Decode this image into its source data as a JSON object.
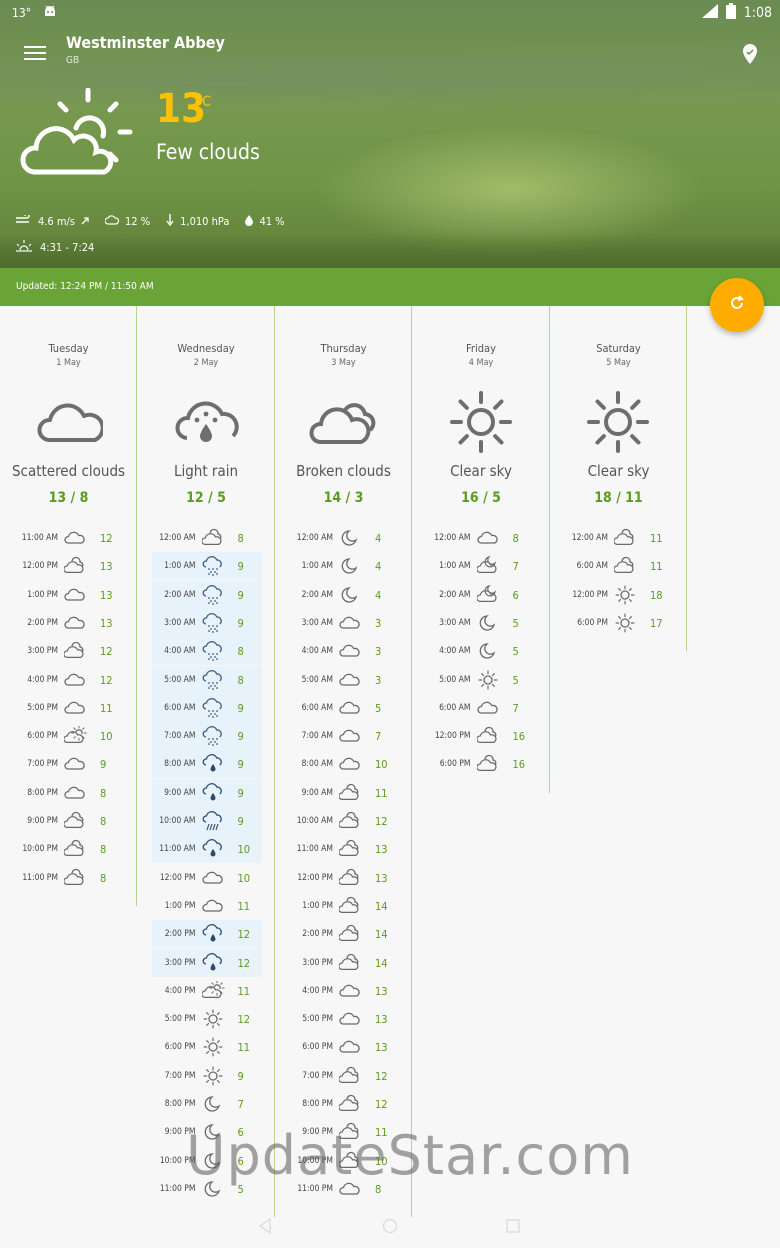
{
  "status": {
    "temp": "13°",
    "time": "1:08",
    "network": "LTE"
  },
  "location": {
    "name": "Westminster Abbey",
    "country": "GB"
  },
  "current": {
    "temp": "13",
    "unit": "°C",
    "condition": "Few clouds",
    "wind": "4.6 m/s",
    "clouds": "12 %",
    "pressure": "1,010 hPa",
    "humidity": "41 %",
    "sun": "4:31 - 7:24"
  },
  "updated": "Updated: 12:24 PM / 11:50 AM",
  "colors": {
    "accent": "#ffab00",
    "green": "#6aa336",
    "temp_yellow": "#ffc107",
    "value_green": "#5b9b1f"
  },
  "days": [
    {
      "name": "Tuesday",
      "date": "1 May",
      "icon": "cloud",
      "condition": "Scattered clouds",
      "range": "13 / 8",
      "hours": [
        {
          "t": "11:00 AM",
          "i": "cloud",
          "v": "12"
        },
        {
          "t": "12:00 PM",
          "i": "clouds",
          "v": "13"
        },
        {
          "t": "1:00 PM",
          "i": "cloud",
          "v": "13"
        },
        {
          "t": "2:00 PM",
          "i": "cloud",
          "v": "13"
        },
        {
          "t": "3:00 PM",
          "i": "clouds",
          "v": "12"
        },
        {
          "t": "4:00 PM",
          "i": "cloud",
          "v": "12"
        },
        {
          "t": "5:00 PM",
          "i": "cloud",
          "v": "11"
        },
        {
          "t": "6:00 PM",
          "i": "sun-cloud",
          "v": "10"
        },
        {
          "t": "7:00 PM",
          "i": "cloud",
          "v": "9"
        },
        {
          "t": "8:00 PM",
          "i": "cloud",
          "v": "8"
        },
        {
          "t": "9:00 PM",
          "i": "clouds",
          "v": "8"
        },
        {
          "t": "10:00 PM",
          "i": "clouds",
          "v": "8"
        },
        {
          "t": "11:00 PM",
          "i": "clouds",
          "v": "8"
        }
      ]
    },
    {
      "name": "Wednesday",
      "date": "2 May",
      "icon": "rain",
      "condition": "Light rain",
      "range": "12 / 5",
      "hours": [
        {
          "t": "12:00 AM",
          "i": "clouds",
          "v": "8"
        },
        {
          "t": "1:00 AM",
          "i": "snow",
          "v": "9",
          "r": 1
        },
        {
          "t": "2:00 AM",
          "i": "snow",
          "v": "9",
          "r": 1
        },
        {
          "t": "3:00 AM",
          "i": "snow",
          "v": "9",
          "r": 1
        },
        {
          "t": "4:00 AM",
          "i": "snow",
          "v": "8",
          "r": 1
        },
        {
          "t": "5:00 AM",
          "i": "snow",
          "v": "8",
          "r": 1
        },
        {
          "t": "6:00 AM",
          "i": "snow",
          "v": "9",
          "r": 1
        },
        {
          "t": "7:00 AM",
          "i": "snow",
          "v": "9",
          "r": 1
        },
        {
          "t": "8:00 AM",
          "i": "rain",
          "v": "9",
          "r": 1
        },
        {
          "t": "9:00 AM",
          "i": "rain",
          "v": "9",
          "r": 1
        },
        {
          "t": "10:00 AM",
          "i": "showers",
          "v": "9",
          "r": 1
        },
        {
          "t": "11:00 AM",
          "i": "rain",
          "v": "10",
          "r": 1
        },
        {
          "t": "12:00 PM",
          "i": "cloud",
          "v": "10"
        },
        {
          "t": "1:00 PM",
          "i": "cloud",
          "v": "11"
        },
        {
          "t": "2:00 PM",
          "i": "rain",
          "v": "12",
          "r": 1
        },
        {
          "t": "3:00 PM",
          "i": "rain",
          "v": "12",
          "r": 1
        },
        {
          "t": "4:00 PM",
          "i": "sun-cloud",
          "v": "11"
        },
        {
          "t": "5:00 PM",
          "i": "sun",
          "v": "12"
        },
        {
          "t": "6:00 PM",
          "i": "sun",
          "v": "11"
        },
        {
          "t": "7:00 PM",
          "i": "sun",
          "v": "9"
        },
        {
          "t": "8:00 PM",
          "i": "moon",
          "v": "7"
        },
        {
          "t": "9:00 PM",
          "i": "moon",
          "v": "6"
        },
        {
          "t": "10:00 PM",
          "i": "moon",
          "v": "6"
        },
        {
          "t": "11:00 PM",
          "i": "moon",
          "v": "5"
        }
      ]
    },
    {
      "name": "Thursday",
      "date": "3 May",
      "icon": "clouds",
      "condition": "Broken clouds",
      "range": "14 / 3",
      "hours": [
        {
          "t": "12:00 AM",
          "i": "moon",
          "v": "4"
        },
        {
          "t": "1:00 AM",
          "i": "moon",
          "v": "4"
        },
        {
          "t": "2:00 AM",
          "i": "moon",
          "v": "4"
        },
        {
          "t": "3:00 AM",
          "i": "cloud",
          "v": "3"
        },
        {
          "t": "4:00 AM",
          "i": "cloud",
          "v": "3"
        },
        {
          "t": "5:00 AM",
          "i": "cloud",
          "v": "3"
        },
        {
          "t": "6:00 AM",
          "i": "cloud",
          "v": "5"
        },
        {
          "t": "7:00 AM",
          "i": "cloud",
          "v": "7"
        },
        {
          "t": "8:00 AM",
          "i": "cloud",
          "v": "10"
        },
        {
          "t": "9:00 AM",
          "i": "clouds",
          "v": "11"
        },
        {
          "t": "10:00 AM",
          "i": "clouds",
          "v": "12"
        },
        {
          "t": "11:00 AM",
          "i": "clouds",
          "v": "13"
        },
        {
          "t": "12:00 PM",
          "i": "clouds",
          "v": "13"
        },
        {
          "t": "1:00 PM",
          "i": "clouds",
          "v": "14"
        },
        {
          "t": "2:00 PM",
          "i": "clouds",
          "v": "14"
        },
        {
          "t": "3:00 PM",
          "i": "clouds",
          "v": "14"
        },
        {
          "t": "4:00 PM",
          "i": "cloud",
          "v": "13"
        },
        {
          "t": "5:00 PM",
          "i": "cloud",
          "v": "13"
        },
        {
          "t": "6:00 PM",
          "i": "cloud",
          "v": "13"
        },
        {
          "t": "7:00 PM",
          "i": "clouds",
          "v": "12"
        },
        {
          "t": "8:00 PM",
          "i": "clouds",
          "v": "12"
        },
        {
          "t": "9:00 PM",
          "i": "clouds",
          "v": "11"
        },
        {
          "t": "10:00 PM",
          "i": "clouds",
          "v": "10"
        },
        {
          "t": "11:00 PM",
          "i": "cloud",
          "v": "8"
        }
      ]
    },
    {
      "name": "Friday",
      "date": "4 May",
      "icon": "sun",
      "condition": "Clear sky",
      "range": "16 / 5",
      "hours": [
        {
          "t": "12:00 AM",
          "i": "cloud",
          "v": "8"
        },
        {
          "t": "1:00 AM",
          "i": "moon-cloud",
          "v": "7"
        },
        {
          "t": "2:00 AM",
          "i": "moon-cloud",
          "v": "6"
        },
        {
          "t": "3:00 AM",
          "i": "moon",
          "v": "5"
        },
        {
          "t": "4:00 AM",
          "i": "moon",
          "v": "5"
        },
        {
          "t": "5:00 AM",
          "i": "sun",
          "v": "5"
        },
        {
          "t": "6:00 AM",
          "i": "cloud",
          "v": "7"
        },
        {
          "t": "12:00 PM",
          "i": "clouds",
          "v": "16"
        },
        {
          "t": "6:00 PM",
          "i": "clouds",
          "v": "16"
        }
      ]
    },
    {
      "name": "Saturday",
      "date": "5 May",
      "icon": "sun",
      "condition": "Clear sky",
      "range": "18 / 11",
      "hours": [
        {
          "t": "12:00 AM",
          "i": "clouds",
          "v": "11"
        },
        {
          "t": "6:00 AM",
          "i": "clouds",
          "v": "11"
        },
        {
          "t": "12:00 PM",
          "i": "sun",
          "v": "18"
        },
        {
          "t": "6:00 PM",
          "i": "sun",
          "v": "17"
        }
      ]
    }
  ],
  "watermark": "UpdateStar.com"
}
